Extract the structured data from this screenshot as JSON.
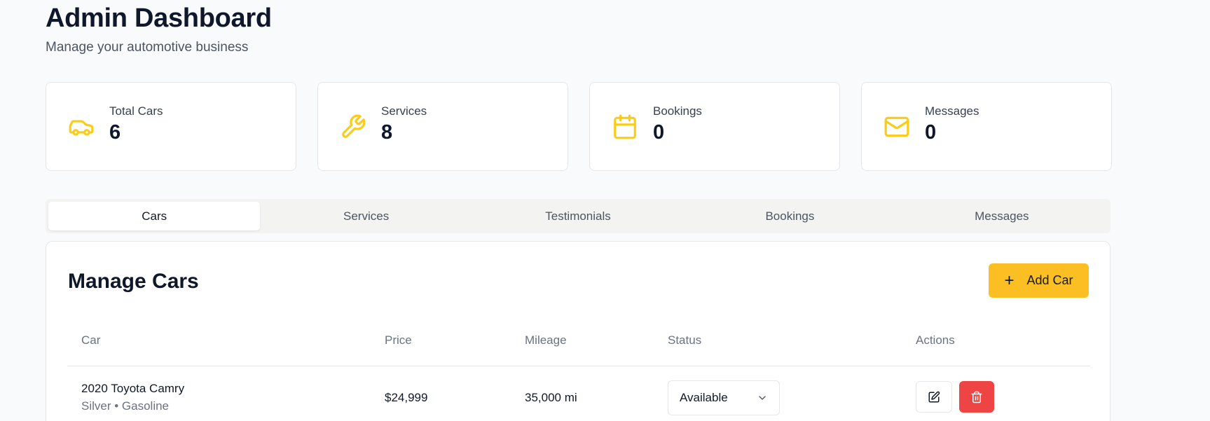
{
  "header": {
    "title": "Admin Dashboard",
    "subtitle": "Manage your automotive business"
  },
  "stats": [
    {
      "label": "Total Cars",
      "value": "6",
      "icon": "car-icon"
    },
    {
      "label": "Services",
      "value": "8",
      "icon": "wrench-icon"
    },
    {
      "label": "Bookings",
      "value": "0",
      "icon": "calendar-icon"
    },
    {
      "label": "Messages",
      "value": "0",
      "icon": "mail-icon"
    }
  ],
  "tabs": [
    {
      "label": "Cars",
      "active": true
    },
    {
      "label": "Services",
      "active": false
    },
    {
      "label": "Testimonials",
      "active": false
    },
    {
      "label": "Bookings",
      "active": false
    },
    {
      "label": "Messages",
      "active": false
    }
  ],
  "panel": {
    "title": "Manage Cars",
    "add_button_label": "Add Car"
  },
  "table": {
    "columns": [
      "Car",
      "Price",
      "Mileage",
      "Status",
      "Actions"
    ],
    "rows": [
      {
        "name": "2020 Toyota Camry",
        "meta": "Silver • Gasoline",
        "price": "$24,999",
        "mileage": "35,000 mi",
        "status": "Available"
      }
    ]
  },
  "colors": {
    "accent": "#fbbf24",
    "icon": "#facc15",
    "danger": "#ef4444"
  }
}
